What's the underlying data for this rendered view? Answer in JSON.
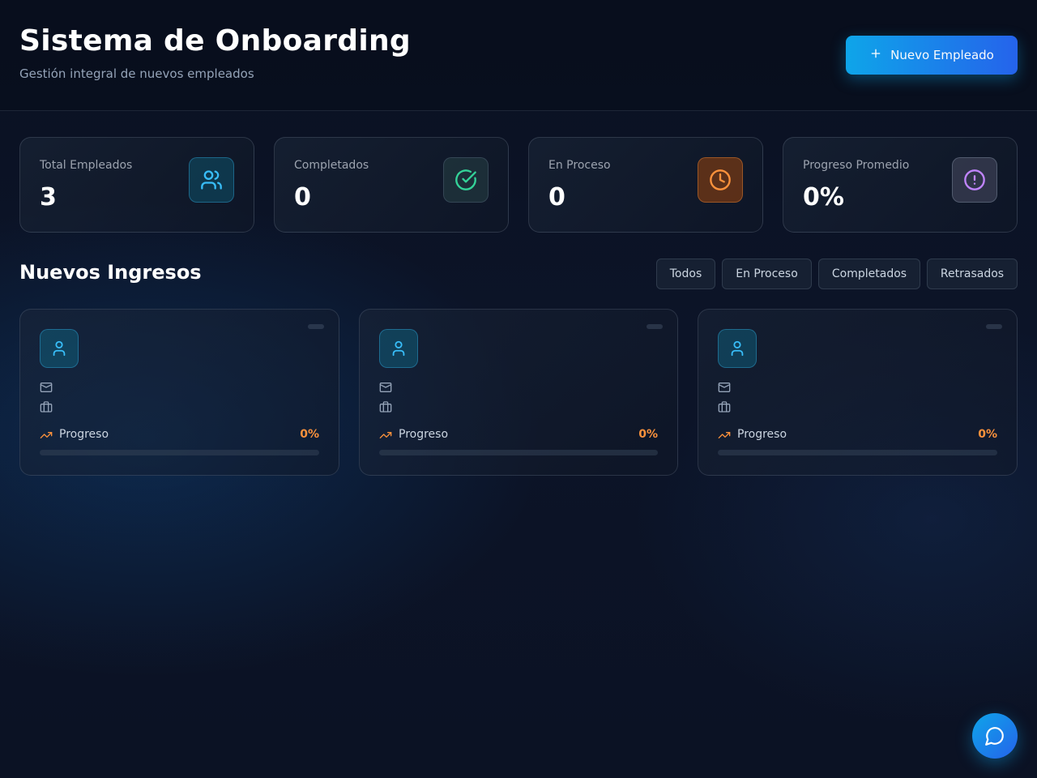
{
  "header": {
    "title": "Sistema de Onboarding",
    "subtitle": "Gestión integral de nuevos empleados",
    "new_button_label": "Nuevo Empleado",
    "new_button_icon": "plus-icon"
  },
  "stats": [
    {
      "label": "Total Empleados",
      "value": "3",
      "icon": "users-icon",
      "color": "#38bdf8"
    },
    {
      "label": "Completados",
      "value": "0",
      "icon": "check-circle-icon",
      "color": "#34d399"
    },
    {
      "label": "En Proceso",
      "value": "0",
      "icon": "clock-icon",
      "color": "#fb923c"
    },
    {
      "label": "Progreso Promedio",
      "value": "0%",
      "icon": "alert-circle-icon",
      "color": "#c084fc"
    }
  ],
  "section": {
    "title": "Nuevos Ingresos",
    "filters": [
      "Todos",
      "En Proceso",
      "Completados",
      "Retrasados"
    ]
  },
  "employees": [
    {
      "progress_label": "Progreso",
      "progress_text": "0%",
      "progress": 0
    },
    {
      "progress_label": "Progreso",
      "progress_text": "0%",
      "progress": 0
    },
    {
      "progress_label": "Progreso",
      "progress_text": "0%",
      "progress": 0
    }
  ],
  "colors": {
    "accent": "#0ea5e9",
    "accent_end": "#2563eb",
    "progress": "#fb923c"
  },
  "chat": {
    "icon": "message-circle-icon"
  }
}
